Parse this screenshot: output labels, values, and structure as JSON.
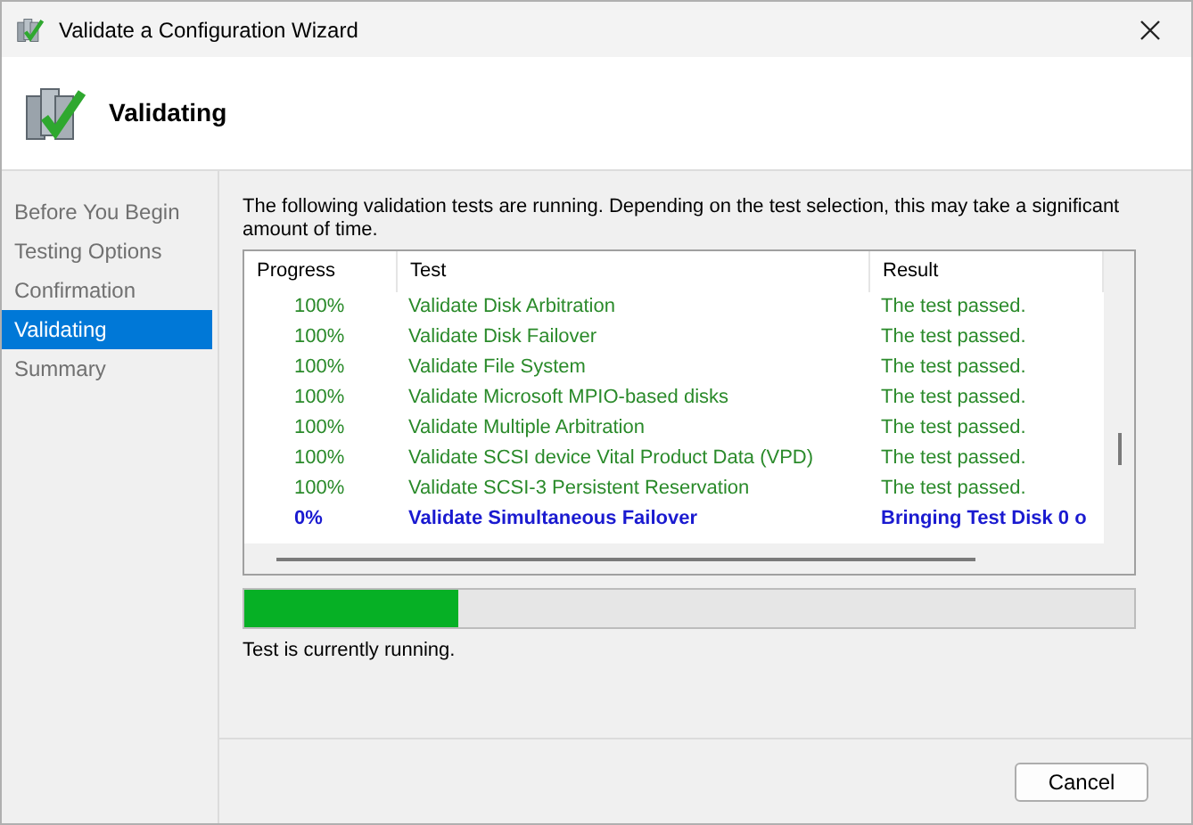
{
  "window": {
    "title": "Validate a Configuration Wizard"
  },
  "header": {
    "title": "Validating"
  },
  "sidebar": {
    "items": [
      {
        "label": "Before You Begin",
        "selected": false
      },
      {
        "label": "Testing Options",
        "selected": false
      },
      {
        "label": "Confirmation",
        "selected": false
      },
      {
        "label": "Validating",
        "selected": true
      },
      {
        "label": "Summary",
        "selected": false
      }
    ]
  },
  "description": "The following validation tests are running. Depending on the test selection, this may take a significant amount of time.",
  "table": {
    "columns": [
      "Progress",
      "Test",
      "Result"
    ],
    "rows": [
      {
        "kind": "passed",
        "progress": "100%",
        "test": "Validate Disk Arbitration",
        "result": "The test passed."
      },
      {
        "kind": "passed",
        "progress": "100%",
        "test": "Validate Disk Failover",
        "result": "The test passed."
      },
      {
        "kind": "passed",
        "progress": "100%",
        "test": "Validate File System",
        "result": "The test passed."
      },
      {
        "kind": "passed",
        "progress": "100%",
        "test": "Validate Microsoft MPIO-based disks",
        "result": "The test passed."
      },
      {
        "kind": "passed",
        "progress": "100%",
        "test": "Validate Multiple Arbitration",
        "result": "The test passed."
      },
      {
        "kind": "passed",
        "progress": "100%",
        "test": "Validate SCSI device Vital Product Data (VPD)",
        "result": "The test passed."
      },
      {
        "kind": "passed",
        "progress": "100%",
        "test": "Validate SCSI-3 Persistent Reservation",
        "result": "The test passed."
      },
      {
        "kind": "running",
        "progress": "0%",
        "test": "Validate Simultaneous Failover",
        "result": "Bringing Test Disk 0 o"
      }
    ]
  },
  "progress": {
    "level": 0.24
  },
  "status_text": "Test is currently running.",
  "buttons": [
    "Cancel"
  ]
}
